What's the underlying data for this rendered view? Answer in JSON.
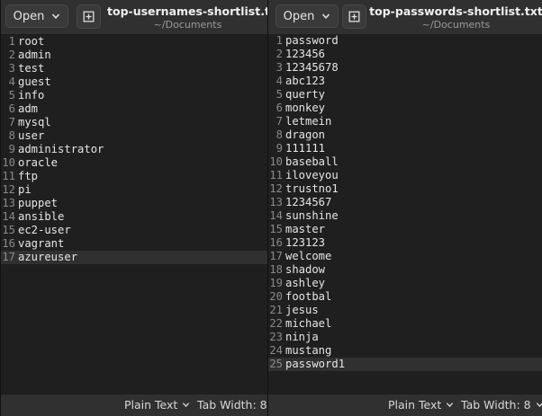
{
  "left": {
    "open_label": "Open",
    "title": "top-usernames-shortlist.txt",
    "subtitle": "~/Documents",
    "lines": [
      "root",
      "admin",
      "test",
      "guest",
      "info",
      "adm",
      "mysql",
      "user",
      "administrator",
      "oracle",
      "ftp",
      "pi",
      "puppet",
      "ansible",
      "ec2-user",
      "vagrant",
      "azureuser"
    ],
    "line_numbers": [
      "1",
      "2",
      "3",
      "4",
      "5",
      "6",
      "7",
      "8",
      "9",
      "10",
      "11",
      "12",
      "13",
      "14",
      "15",
      "16",
      "17"
    ],
    "current_line": 17,
    "status": {
      "syntax": "Plain Text",
      "tab_width": "Tab Width: 8"
    }
  },
  "right": {
    "open_label": "Open",
    "title": "top-passwords-shortlist.txt",
    "subtitle": "~/Documents",
    "lines": [
      "password",
      "123456",
      "12345678",
      "abc123",
      "querty",
      "monkey",
      "letmein",
      "dragon",
      "111111",
      "baseball",
      "iloveyou",
      "trustno1",
      "1234567",
      "sunshine",
      "master",
      "123123",
      "welcome",
      "shadow",
      "ashley",
      "footbal",
      "jesus",
      "michael",
      "ninja",
      "mustang",
      "password1"
    ],
    "line_numbers": [
      "1",
      "2",
      "3",
      "4",
      "5",
      "6",
      "7",
      "8",
      "9",
      "10",
      "11",
      "12",
      "13",
      "14",
      "15",
      "16",
      "17",
      "18",
      "19",
      "20",
      "21",
      "22",
      "23",
      "24",
      "25"
    ],
    "current_line": 25,
    "status": {
      "syntax": "Plain Text",
      "tab_width": "Tab Width: 8"
    }
  },
  "icons": {
    "open_dropdown": "chevron-down-icon",
    "new_tab": "new-tab-icon"
  }
}
